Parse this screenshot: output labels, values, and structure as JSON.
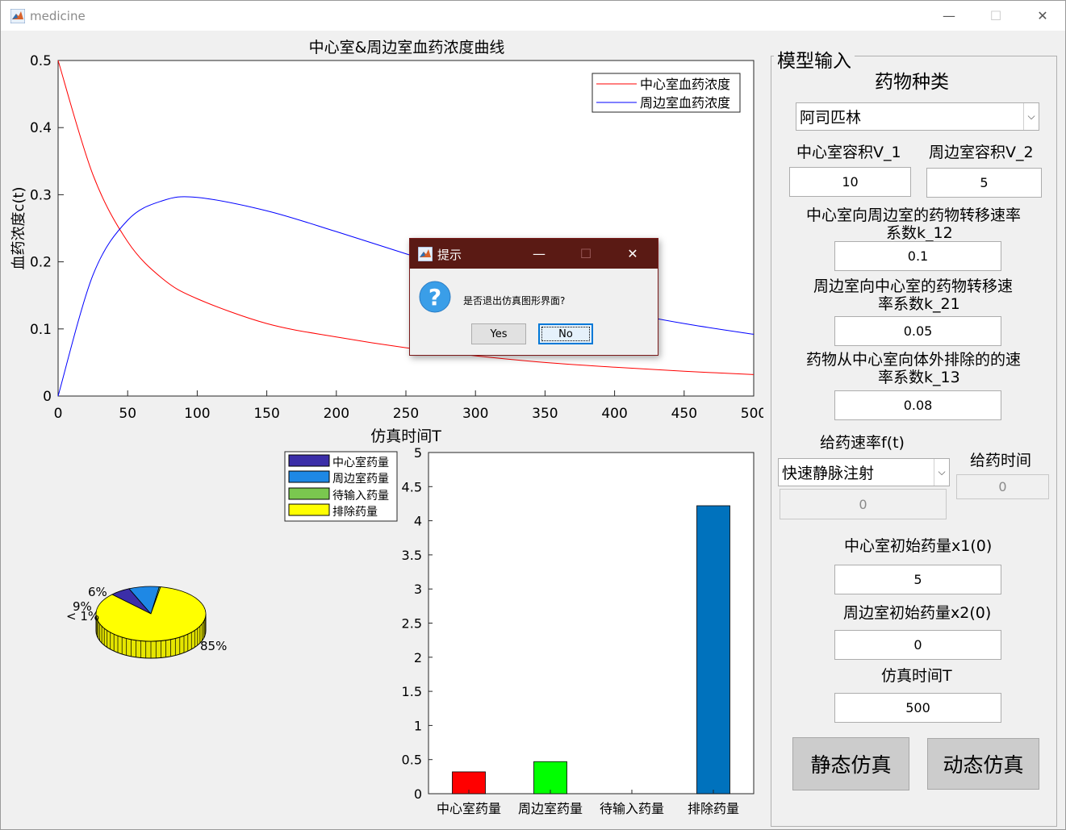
{
  "window": {
    "title": "medicine"
  },
  "curve_chart": {
    "title": "中心室&周边室血药浓度曲线",
    "xlabel": "仿真时间T",
    "ylabel": "血药浓度c(t)",
    "xticks": [
      "0",
      "50",
      "100",
      "150",
      "200",
      "250",
      "300",
      "350",
      "400",
      "450",
      "500"
    ],
    "yticks": [
      "0",
      "0.1",
      "0.2",
      "0.3",
      "0.4",
      "0.5"
    ],
    "legend": [
      "中心室血药浓度",
      "周边室血药浓度"
    ],
    "colors": {
      "central": "#ff0000",
      "peripheral": "#0000ff"
    }
  },
  "pie_chart": {
    "legend": [
      "中心室药量",
      "周边室药量",
      "待输入药量",
      "排除药量"
    ],
    "labels": [
      "6%",
      "9%",
      "< 1%",
      "85%"
    ],
    "colors": [
      "#3b2ea8",
      "#1e88e5",
      "#7ac74f",
      "#ffff00"
    ]
  },
  "bar_chart": {
    "yticks": [
      "0",
      "0.5",
      "1",
      "1.5",
      "2",
      "2.5",
      "3",
      "3.5",
      "4",
      "4.5",
      "5"
    ],
    "categories": [
      "中心室药量",
      "周边室药量",
      "待输入药量",
      "排除药量"
    ],
    "colors": [
      "#ff0000",
      "#00ff00",
      "#ffffff",
      "#0072bd"
    ]
  },
  "chart_data": [
    {
      "type": "line",
      "title": "中心室&周边室血药浓度曲线",
      "xlabel": "仿真时间T",
      "ylabel": "血药浓度c(t)",
      "xlim": [
        0,
        500
      ],
      "ylim": [
        0,
        0.5
      ],
      "grid": false,
      "legend_position": "top-right",
      "x": [
        0,
        25,
        50,
        75,
        100,
        150,
        200,
        250,
        300,
        350,
        400,
        450,
        500
      ],
      "series": [
        {
          "name": "中心室血药浓度",
          "values": [
            0.5,
            0.33,
            0.23,
            0.175,
            0.145,
            0.108,
            0.088,
            0.072,
            0.06,
            0.05,
            0.043,
            0.037,
            0.032
          ]
        },
        {
          "name": "周边室血药浓度",
          "values": [
            0.0,
            0.18,
            0.262,
            0.291,
            0.296,
            0.276,
            0.245,
            0.212,
            0.18,
            0.153,
            0.128,
            0.108,
            0.092
          ]
        }
      ]
    },
    {
      "type": "pie",
      "categories": [
        "中心室药量",
        "周边室药量",
        "待输入药量",
        "排除药量"
      ],
      "values": [
        6,
        9,
        0.4,
        85
      ],
      "labels": [
        "6%",
        "9%",
        "< 1%",
        "85%"
      ]
    },
    {
      "type": "bar",
      "categories": [
        "中心室药量",
        "周边室药量",
        "待输入药量",
        "排除药量"
      ],
      "values": [
        0.32,
        0.47,
        0,
        4.22
      ],
      "ylim": [
        0,
        5
      ],
      "grid": false
    }
  ],
  "panel": {
    "title": "模型输入",
    "drug_label": "药物种类",
    "drug_value": "阿司匹林",
    "v1_label": "中心室容积V_1",
    "v1_value": "10",
    "v2_label": "周边室容积V_2",
    "v2_value": "5",
    "k12_label_1": "中心室向周边室的药物转移速率",
    "k12_label_2": "系数k_12",
    "k12_value": "0.1",
    "k21_label_1": "周边室向中心室的药物转移速",
    "k21_label_2": "率系数k_21",
    "k21_value": "0.05",
    "k13_label_1": "药物从中心室向体外排除的的速",
    "k13_label_2": "率系数k_13",
    "k13_value": "0.08",
    "rate_label": "给药速率f(t)",
    "rate_value": "快速静脉注射",
    "rate_input": "0",
    "time_label": "给药时间",
    "time_input": "0",
    "x1_label": "中心室初始药量x1(0)",
    "x1_value": "5",
    "x2_label": "周边室初始药量x2(0)",
    "x2_value": "0",
    "T_label": "仿真时间T",
    "T_value": "500",
    "static_btn": "静态仿真",
    "dynamic_btn": "动态仿真"
  },
  "dialog": {
    "title": "提示",
    "message": "是否退出仿真图形界面?",
    "yes": "Yes",
    "no": "No"
  }
}
